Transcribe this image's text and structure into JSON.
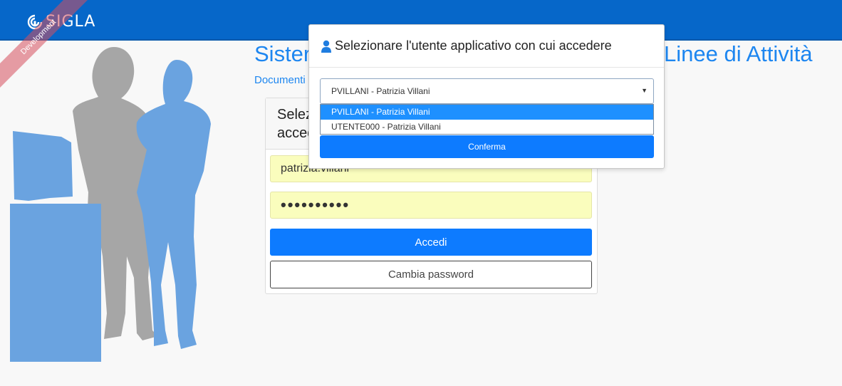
{
  "header": {
    "brand": "SIGLA",
    "ribbon": "Development",
    "bar_color": "#0667c9"
  },
  "page": {
    "title_left": "Sister",
    "title_right": "Linee di Attività",
    "subtitle": "Documenti"
  },
  "login": {
    "header_text": "Selez\nacced",
    "username_value": "patrizia.villani",
    "password_value": "••••••••••",
    "accedi_label": "Accedi",
    "cambia_password_label": "Cambia password"
  },
  "modal": {
    "title": "Selezionare l'utente applicativo con cui accedere",
    "selected_value": "PVILLANI - Patrizia Villani",
    "options": [
      {
        "label": "PVILLANI - Patrizia Villani",
        "selected": true
      },
      {
        "label": "UTENTE000 - Patrizia Villani",
        "selected": false
      }
    ],
    "confirm_label": "Conferma"
  },
  "icons": {
    "brand": "cnr-logo-icon",
    "modal_title": "user-icon",
    "select": "caret-down-icon"
  },
  "colors": {
    "accent": "#0d7bff",
    "title_text": "#1d86f0",
    "autofill": "#fafdbd",
    "option_highlight": "#1e90ff"
  }
}
